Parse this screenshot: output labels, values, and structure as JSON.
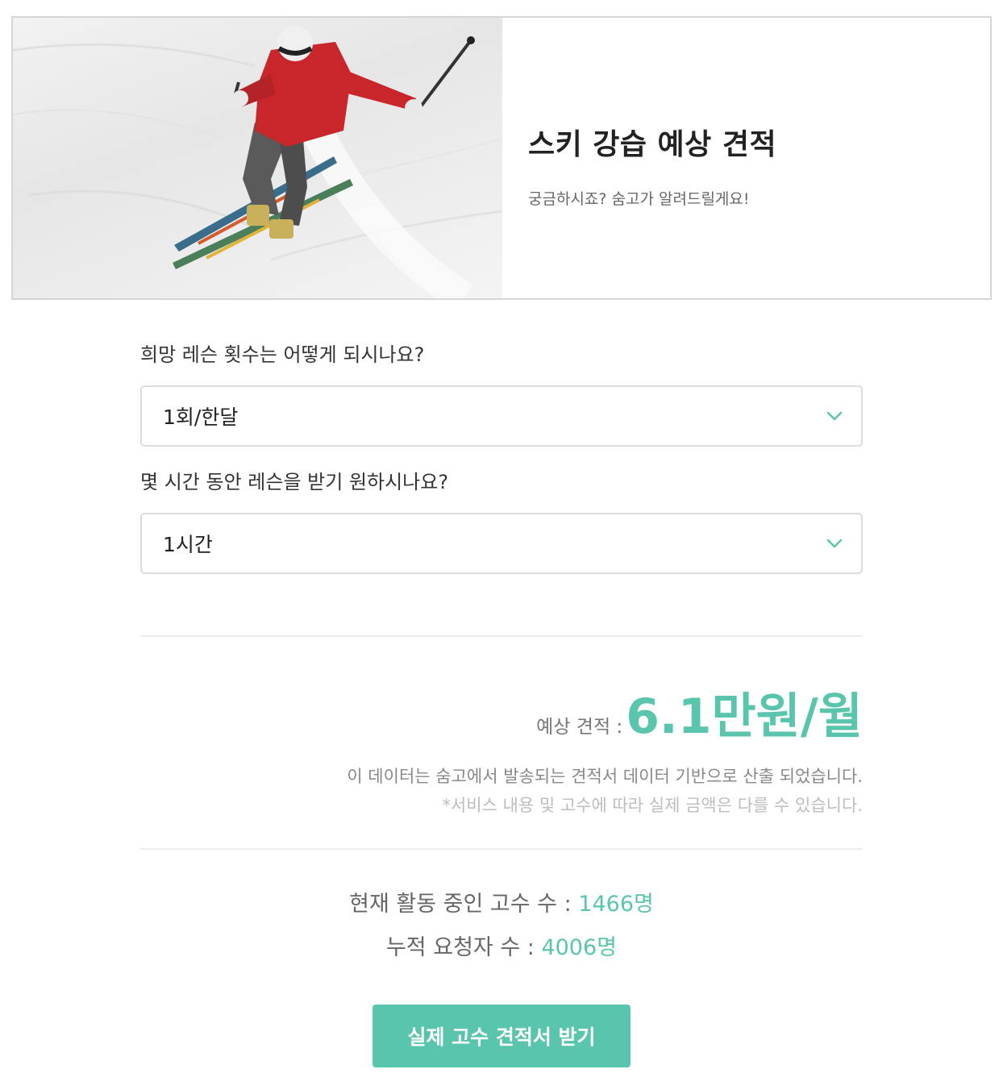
{
  "hero": {
    "title": "스키 강습 예상 견적",
    "subtitle": "궁금하시죠? 숨고가 알려드릴게요!"
  },
  "form": {
    "q1": {
      "label": "희망 레슨 횟수는 어떻게 되시나요?",
      "selected": "1회/한달"
    },
    "q2": {
      "label": "몇 시간 동안 레슨을 받기 원하시나요?",
      "selected": "1시간"
    }
  },
  "estimate": {
    "label": "예상 견적 :",
    "value": "6.1만원/월",
    "note1": "이 데이터는 숨고에서 발송되는 견적서 데이터 기반으로 산출 되었습니다.",
    "note2": "*서비스 내용 및 고수에 따라 실제 금액은 다를 수 있습니다."
  },
  "stats": {
    "active_label": "현재 활동 중인 고수 수 :",
    "active_value": "1466명",
    "requests_label": "누적 요청자 수 :",
    "requests_value": "4006명"
  },
  "cta": {
    "label": "실제 고수 견적서 받기"
  },
  "colors": {
    "accent": "#5ac5ad"
  },
  "icons": {
    "dropdown": "chevron-down-icon"
  }
}
